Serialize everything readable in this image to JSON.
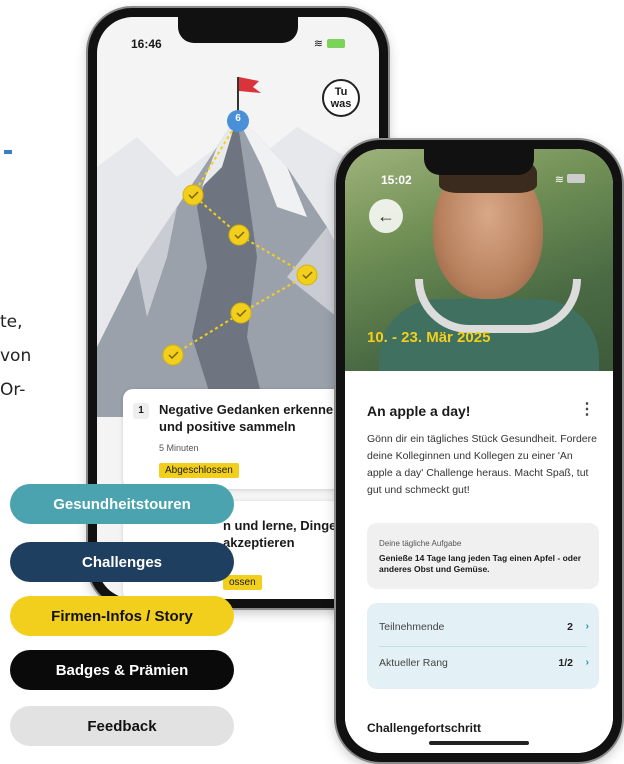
{
  "left_text": {
    "fragment_1": "te,",
    "fragment_2": "von",
    "fragment_3": "Or-"
  },
  "phone1": {
    "time": "16:46",
    "tuwas_logo": "Tu was",
    "summit_step": "6",
    "tasks": [
      {
        "num": "1",
        "title": "Negative Gedanken erkennen und positive sammeln",
        "duration": "5 Minuten",
        "status": "Abgeschlossen"
      },
      {
        "num": "",
        "title": "n und lerne, Dinge zu akzeptieren",
        "duration": "",
        "status": "ossen"
      }
    ]
  },
  "phone2": {
    "time": "15:02",
    "date_range": "10. - 23. Mär 2025",
    "title": "An apple a day!",
    "description": "Gönn dir ein tägliches Stück Gesundheit. Fordere deine Kolleginnen und Kollegen zu einer 'An apple a day' Challenge heraus. Macht Spaß, tut gut und schmeckt gut!",
    "task_label": "Deine tägliche Aufgabe",
    "task_text": "Genieße 14 Tage lang jeden Tag einen Apfel - oder anderes Obst und Gemüse.",
    "stats": [
      {
        "label": "Teilnehmende",
        "value": "2"
      },
      {
        "label": "Aktueller Rang",
        "value": "1/2"
      }
    ],
    "progress_title": "Challengefortschritt"
  },
  "menu": [
    {
      "label": "Gesundheitstouren",
      "bg": "#4aa3ae",
      "fg": "#ffffff"
    },
    {
      "label": "Challenges",
      "bg": "#1f3f60",
      "fg": "#ffffff"
    },
    {
      "label": "Firmen-Infos / Story",
      "bg": "#f2cf1d",
      "fg": "#111111"
    },
    {
      "label": "Badges & Prämien",
      "bg": "#0a0a0a",
      "fg": "#ffffff"
    },
    {
      "label": "Feedback",
      "bg": "#e2e2e2",
      "fg": "#111111"
    }
  ],
  "colors": {
    "accent_yellow": "#f2cf1d",
    "flag_red": "#d9343a",
    "step_blue": "#4a90d9"
  }
}
